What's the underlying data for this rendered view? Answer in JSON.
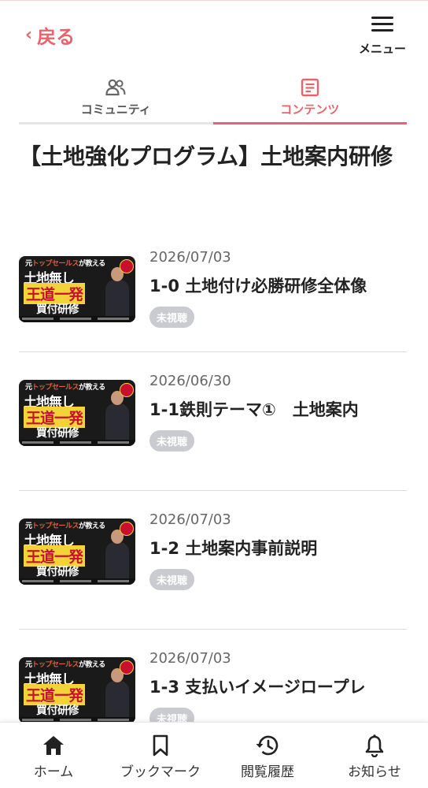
{
  "header": {
    "back_label": "戻る",
    "menu_label": "メニュー"
  },
  "tabs": [
    {
      "label": "コミュニティ",
      "icon": "people-icon",
      "active": false
    },
    {
      "label": "コンテンツ",
      "icon": "document-icon",
      "active": true
    }
  ],
  "page_title": "【土地強化プログラム】土地案内研修",
  "items": [
    {
      "date": "2026/07/03",
      "title": "1-0 土地付け必勝研修全体像",
      "badge": "未視聴"
    },
    {
      "date": "2026/06/30",
      "title": "1-1鉄則テーマ①　土地案内",
      "badge": "未視聴"
    },
    {
      "date": "2026/07/03",
      "title": "1-2 土地案内事前説明",
      "badge": "未視聴"
    },
    {
      "date": "2026/07/03",
      "title": "1-3 支払いイメージロープレ",
      "badge": "未視聴"
    }
  ],
  "thumbnail": {
    "line1_prefix": "元",
    "line1_accent": "トップセールス",
    "line1_suffix": "が教える",
    "line2": "土地無し",
    "line3": "王道一発",
    "line4": "買付研修"
  },
  "bottom_nav": [
    {
      "label": "ホーム",
      "icon": "home-icon"
    },
    {
      "label": "ブックマーク",
      "icon": "bookmark-icon"
    },
    {
      "label": "閲覧履歴",
      "icon": "history-icon"
    },
    {
      "label": "お知らせ",
      "icon": "bell-icon"
    }
  ],
  "colors": {
    "accent": "#e8636b",
    "badge": "#c9cbd1",
    "text": "#222222"
  }
}
